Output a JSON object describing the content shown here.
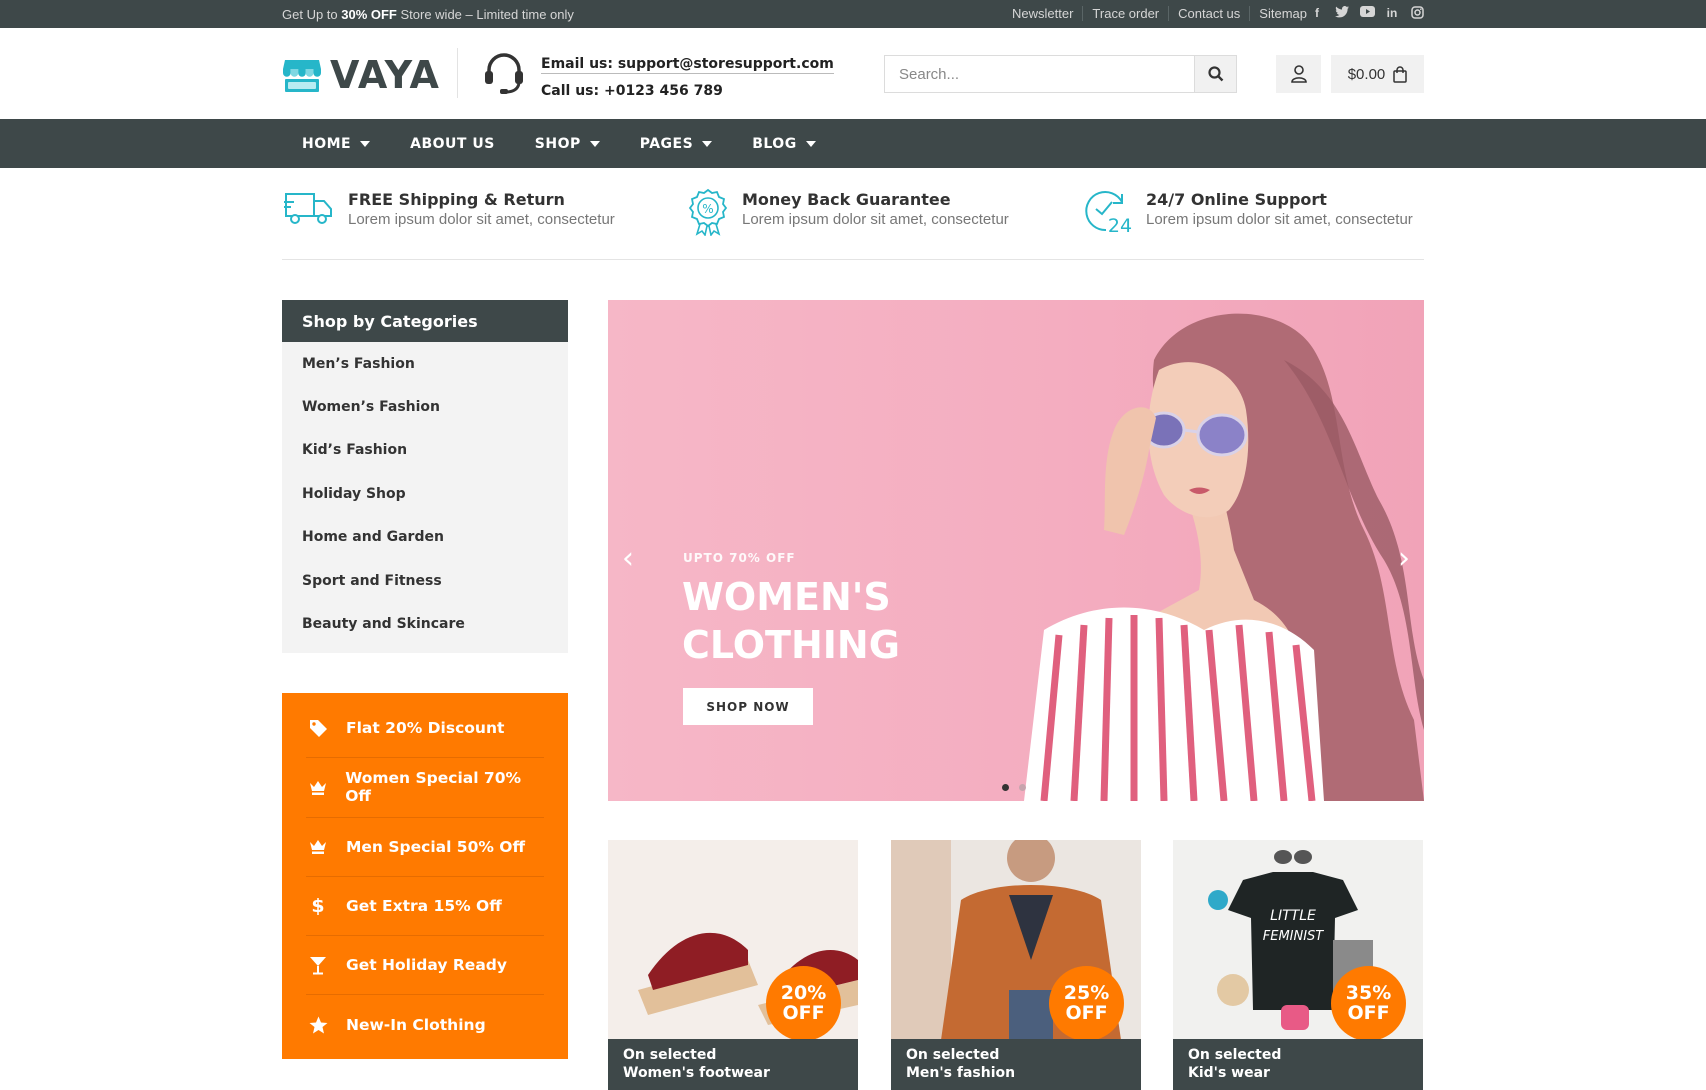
{
  "topbar": {
    "promo_prefix": "Get Up to ",
    "promo_bold": "30% OFF",
    "promo_suffix": " Store wide – Limited time only",
    "links": [
      "Newsletter",
      "Trace order",
      "Contact us",
      "Sitemap"
    ],
    "social_icons": [
      "facebook-icon",
      "twitter-icon",
      "youtube-icon",
      "linkedin-icon",
      "instagram-icon"
    ]
  },
  "header": {
    "logo_text": "VAYA",
    "email": "Email us: support@storesupport.com",
    "phone": "Call us: +0123 456 789",
    "search_placeholder": "Search...",
    "cart_total": "$0.00"
  },
  "nav": {
    "items": [
      {
        "label": "HOME",
        "dropdown": true
      },
      {
        "label": "ABOUT US",
        "dropdown": false
      },
      {
        "label": "SHOP",
        "dropdown": true
      },
      {
        "label": "PAGES",
        "dropdown": true
      },
      {
        "label": "BLOG",
        "dropdown": true
      }
    ]
  },
  "features": [
    {
      "title": "FREE Shipping & Return",
      "desc": "Lorem ipsum dolor sit amet, consectetur",
      "icon": "truck-icon"
    },
    {
      "title": "Money Back Guarantee",
      "desc": "Lorem ipsum dolor sit amet, consectetur",
      "icon": "percent-badge-icon"
    },
    {
      "title": "24/7 Online Support",
      "desc": "Lorem ipsum dolor sit amet, consectetur",
      "icon": "clock-24-icon"
    }
  ],
  "sidebar": {
    "heading": "Shop by Categories",
    "categories": [
      "Men’s Fashion",
      "Women’s Fashion",
      "Kid’s Fashion",
      "Holiday Shop",
      "Home and Garden",
      "Sport and Fitness",
      "Beauty and Skincare"
    ]
  },
  "offers": [
    {
      "label": "Flat 20% Discount",
      "icon": "tag-icon"
    },
    {
      "label": "Women Special 70% Off",
      "icon": "crown-icon"
    },
    {
      "label": "Men Special 50% Off",
      "icon": "crown-icon"
    },
    {
      "label": "Get Extra 15% Off",
      "icon": "dollar-icon"
    },
    {
      "label": "Get Holiday Ready",
      "icon": "cocktail-icon"
    },
    {
      "label": "New-In Clothing",
      "icon": "star-icon"
    }
  ],
  "hero": {
    "tag": "UPTO 70% OFF",
    "title_line1": "WOMEN'S",
    "title_line2": "CLOTHING",
    "button": "SHOP NOW",
    "slides": 2,
    "active_slide": 1
  },
  "banners": [
    {
      "percent": "20%",
      "off": "OFF",
      "line1": "On selected",
      "line2": "Women's footwear"
    },
    {
      "percent": "25%",
      "off": "OFF",
      "line1": "On selected",
      "line2": "Men's fashion"
    },
    {
      "percent": "35%",
      "off": "OFF",
      "line1": "On selected",
      "line2": "Kid's wear"
    }
  ],
  "colors": {
    "dark": "#3e4849",
    "accent": "#ff7a00",
    "teal": "#26b6c9",
    "hero_pink": "#f4adc0"
  }
}
